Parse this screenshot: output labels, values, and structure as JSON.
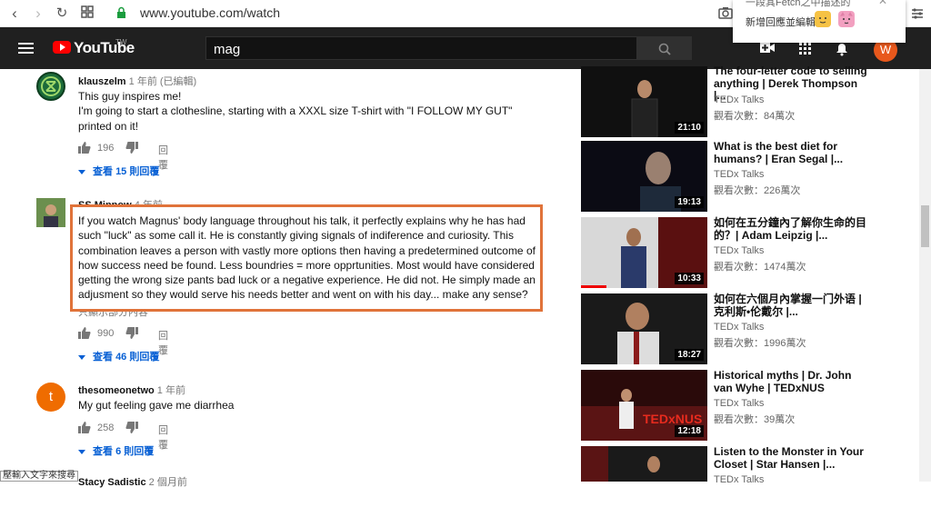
{
  "browser": {
    "url": "www.youtube.com/watch"
  },
  "popup": {
    "top_text": "一段其Fetch之中描述的",
    "text": "新增回應並編輯"
  },
  "header": {
    "brand": "YouTube",
    "brand_suffix": "TW",
    "search_value": "mag",
    "avatar_letter": "W"
  },
  "comments": [
    {
      "author": "klauszelm",
      "time": "1 年前 (已編輯)",
      "text1": "This guy inspires me!",
      "text2": "I'm going to start a clothesline, starting with a XXXL size T-shirt with \"I FOLLOW MY GUT\" printed on it!",
      "likes": "196",
      "reply": "回覆",
      "view_prefix": "查看",
      "view_count": "15",
      "view_suffix": "則回覆"
    },
    {
      "author": "SS Minnow",
      "time": "4 年前",
      "text": "If you watch Magnus' body language throughout his talk, it perfectly explains why he has had such \"luck\" as some call it.  He is constantly giving signals of indiference and curiosity.  This combination leaves a person with vastly more options then having a predetermined outcome of how success need be found.  Less boundries = more opprtunities.  Most would have considered getting the wrong size pants bad luck or a negative experience.  He did not.  He simply made an adjusment so they would serve his needs better and went on with his day... make any sense?",
      "show_less": "只顯示部分內容",
      "likes": "990",
      "reply": "回覆",
      "view_prefix": "查看",
      "view_count": "46",
      "view_suffix": "則回覆"
    },
    {
      "author": "thesomeonetwo",
      "time": "1 年前",
      "avatar_letter": "t",
      "text": "My gut feeling gave me diarrhea",
      "likes": "258",
      "reply": "回覆",
      "view_prefix": "查看",
      "view_count": "6",
      "view_suffix": "則回覆"
    },
    {
      "author": "Stacy Sadistic",
      "time": "2 個月前"
    }
  ],
  "sidebar": [
    {
      "title_partial": "The four-letter code to selling",
      "title": "anything | Derek Thompson |...",
      "channel": "TEDx Talks",
      "views": "觀看次數：84萬次",
      "duration": "21:10"
    },
    {
      "title": "What is the best diet for humans? | Eran Segal |...",
      "channel": "TEDx Talks",
      "views": "觀看次數：226萬次",
      "duration": "19:13"
    },
    {
      "title": "如何在五分鐘內了解你生命的目的？| Adam Leipzig |...",
      "channel": "TEDx Talks",
      "views": "觀看次數：1474萬次",
      "duration": "10:33",
      "progress": 0.2
    },
    {
      "title": "如何在六個月內掌握一门外语 | 克利斯•伦戴尔 |...",
      "channel": "TEDx Talks",
      "views": "觀看次數：1996萬次",
      "duration": "18:27"
    },
    {
      "title": "Historical myths | Dr. John van Wyhe | TEDxNUS",
      "channel": "TEDx Talks",
      "views": "觀看次數：39萬次",
      "duration": "12:18",
      "thumb_text": "TEDxNUS"
    },
    {
      "title": "Listen to the Monster in Your Closet | Star Hansen |...",
      "channel": "TEDx Talks"
    }
  ],
  "tooltip": "壓輸入文字來搜尋",
  "colors": {
    "header_bg": "#202020",
    "link_blue": "#065fd4",
    "highlight": "#e0733a",
    "avatar_orange": "#e8581c"
  }
}
